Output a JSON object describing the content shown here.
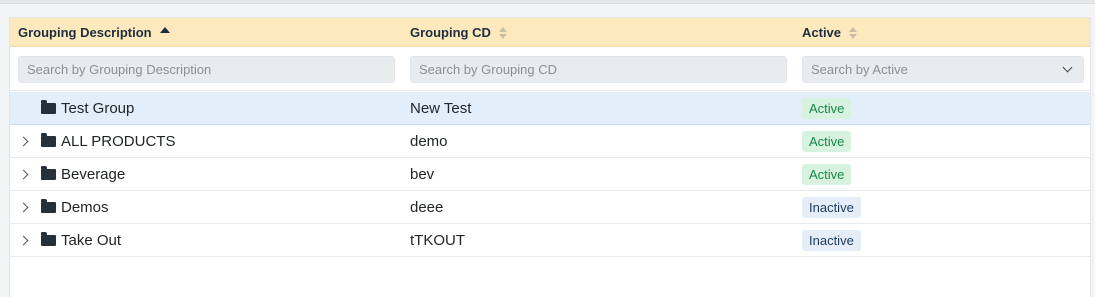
{
  "columns": {
    "description": {
      "label": "Grouping Description",
      "sort": "asc"
    },
    "code": {
      "label": "Grouping CD",
      "sort": "none"
    },
    "active": {
      "label": "Active",
      "sort": "none"
    }
  },
  "filters": {
    "description_placeholder": "Search by Grouping Description",
    "code_placeholder": "Search by Grouping CD",
    "active_placeholder": "Search by Active"
  },
  "rows": [
    {
      "description": "Test Group",
      "code": "New Test",
      "status": "Active",
      "expandable": false,
      "selected": true
    },
    {
      "description": "ALL PRODUCTS",
      "code": "demo",
      "status": "Active",
      "expandable": true,
      "selected": false
    },
    {
      "description": "Beverage",
      "code": "bev",
      "status": "Active",
      "expandable": true,
      "selected": false
    },
    {
      "description": "Demos",
      "code": "deee",
      "status": "Inactive",
      "expandable": true,
      "selected": false
    },
    {
      "description": "Take Out",
      "code": "tTKOUT",
      "status": "Inactive",
      "expandable": true,
      "selected": false
    }
  ],
  "colors": {
    "header_bg": "#fde9be",
    "selected_row_bg": "#e3eefb",
    "active_badge_bg": "#d7f3e0",
    "active_badge_text": "#17874a",
    "inactive_badge_bg": "#e5edf8",
    "inactive_badge_text": "#1d3a5f"
  },
  "icons": {
    "row_icon": "folder-icon",
    "expand_icon": "chevron-right-icon",
    "sort_icon": "sort-ascending-icon",
    "select_icon": "chevron-down-icon"
  }
}
